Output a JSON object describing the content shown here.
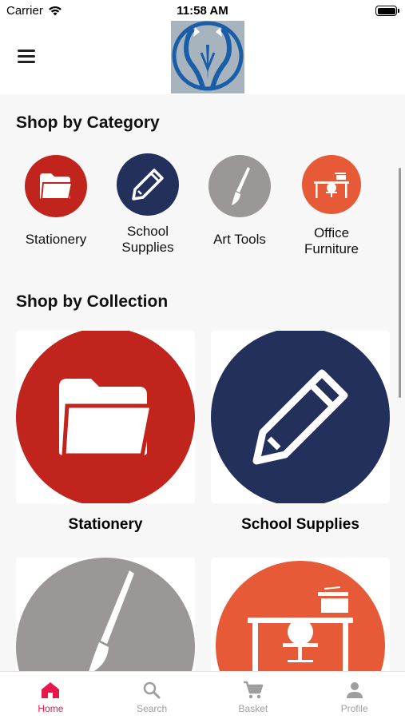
{
  "status": {
    "carrier": "Carrier",
    "time": "11:58 AM"
  },
  "header": {
    "menu_icon": "hamburger-icon",
    "logo": "brand-logo"
  },
  "categories_section": {
    "title": "Shop by Category",
    "items": [
      {
        "label": "Stationery",
        "icon": "folder-icon",
        "color": "#c0241c"
      },
      {
        "label": "School Supplies",
        "icon": "pencil-icon",
        "color": "#23305c"
      },
      {
        "label": "Art Tools",
        "icon": "paintbrush-icon",
        "color": "#9a9796"
      },
      {
        "label": "Office Furniture",
        "icon": "desk-icon",
        "color": "#e75a37"
      }
    ]
  },
  "collections_section": {
    "title": "Shop by Collection",
    "items": [
      {
        "label": "Stationery",
        "icon": "folder-icon",
        "color": "#c0241c"
      },
      {
        "label": "School Supplies",
        "icon": "pencil-icon",
        "color": "#23305c"
      },
      {
        "label": "",
        "icon": "paintbrush-icon",
        "color": "#9a9796"
      },
      {
        "label": "",
        "icon": "desk-icon",
        "color": "#e75a37"
      }
    ]
  },
  "tabs": [
    {
      "label": "Home",
      "icon": "home-icon",
      "active": true
    },
    {
      "label": "Search",
      "icon": "search-icon",
      "active": false
    },
    {
      "label": "Basket",
      "icon": "cart-icon",
      "active": false
    },
    {
      "label": "Profile",
      "icon": "profile-icon",
      "active": false
    }
  ],
  "accent_color": "#e8174b"
}
